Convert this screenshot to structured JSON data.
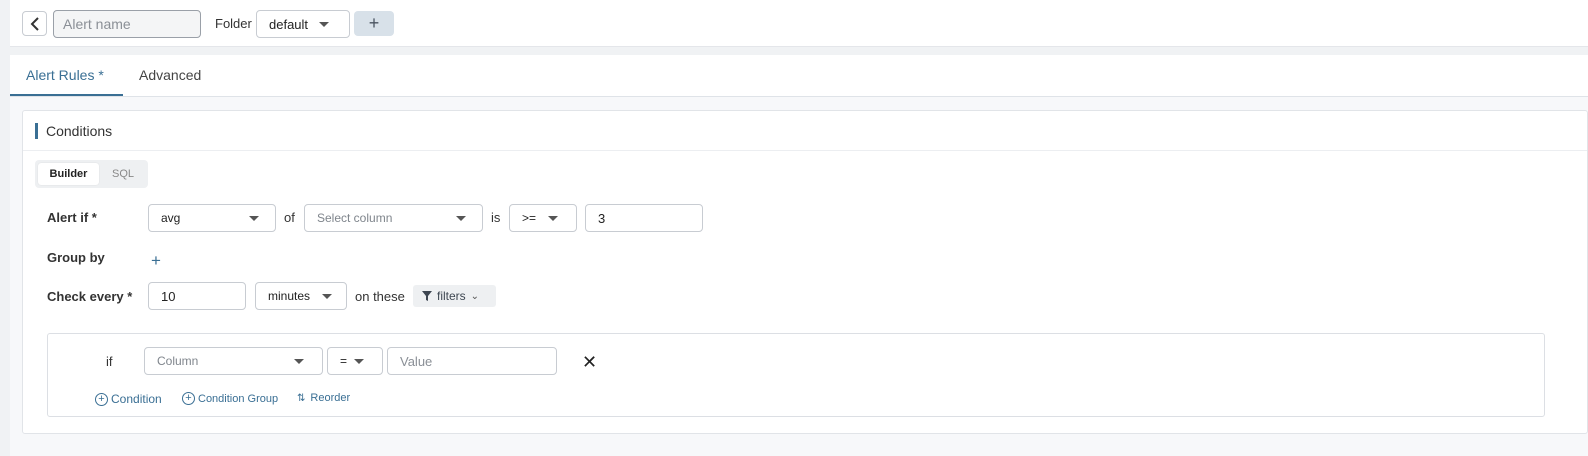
{
  "header": {
    "alert_name_placeholder": "Alert name",
    "folder_label": "Folder",
    "folder_value": "default",
    "add_folder_label": "+"
  },
  "tabs": [
    {
      "label": "Alert Rules *",
      "active": true
    },
    {
      "label": "Advanced",
      "active": false
    }
  ],
  "conditions": {
    "title": "Conditions",
    "mode_toggle": [
      {
        "label": "Builder",
        "active": true
      },
      {
        "label": "SQL",
        "active": false
      }
    ],
    "alert_if": {
      "label": "Alert if *",
      "aggregation": "avg",
      "of_text": "of",
      "column_placeholder": "Select column",
      "is_text": "is",
      "operator": ">=",
      "threshold": "3"
    },
    "group_by": {
      "label": "Group by",
      "add_label": "+"
    },
    "check_every": {
      "label": "Check every *",
      "value": "10",
      "unit": "minutes",
      "on_these_text": "on these",
      "filters_label": "filters"
    },
    "filter_row": {
      "if_label": "if",
      "column_placeholder": "Column",
      "operator": "=",
      "value_placeholder": "Value",
      "remove_label": "✕"
    },
    "actions": {
      "add_condition": "Condition",
      "add_condition_group": "Condition Group",
      "reorder": "Reorder"
    }
  },
  "colors": {
    "accent": "#3a6f94",
    "background": "#f0f2f4"
  }
}
